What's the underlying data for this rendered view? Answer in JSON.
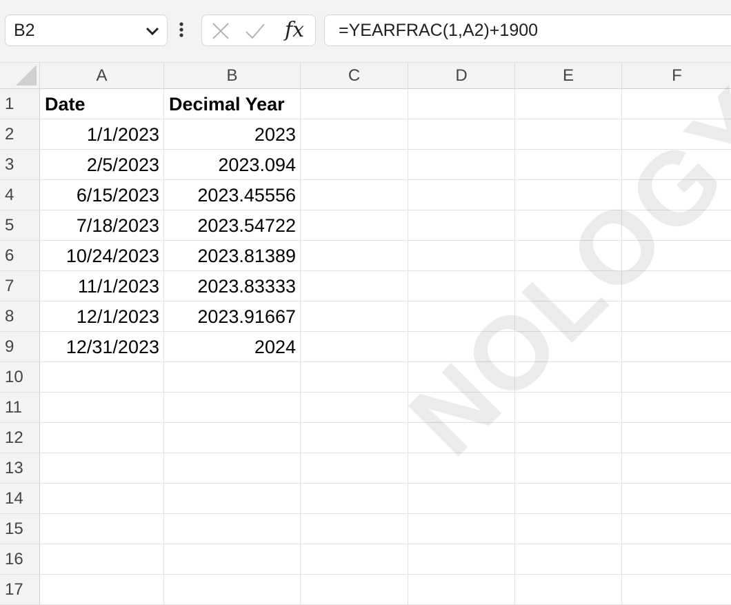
{
  "namebox": {
    "value": "B2"
  },
  "formula_bar": {
    "fx_label": "fx",
    "formula": "=YEARFRAC(1,A2)+1900"
  },
  "columns": [
    "A",
    "B",
    "C",
    "D",
    "E",
    "F"
  ],
  "rows": [
    "1",
    "2",
    "3",
    "4",
    "5",
    "6",
    "7",
    "8",
    "9",
    "10",
    "11",
    "12",
    "13",
    "14",
    "15",
    "16",
    "17"
  ],
  "table": {
    "headers": [
      "Date",
      "Decimal Year"
    ],
    "data": [
      [
        "1/1/2023",
        "2023"
      ],
      [
        "2/5/2023",
        "2023.094"
      ],
      [
        "6/15/2023",
        "2023.45556"
      ],
      [
        "7/18/2023",
        "2023.54722"
      ],
      [
        "10/24/2023",
        "2023.81389"
      ],
      [
        "11/1/2023",
        "2023.83333"
      ],
      [
        "12/1/2023",
        "2023.91667"
      ],
      [
        "12/31/2023",
        "2024"
      ]
    ]
  },
  "watermark": "NOLOGY.CO"
}
